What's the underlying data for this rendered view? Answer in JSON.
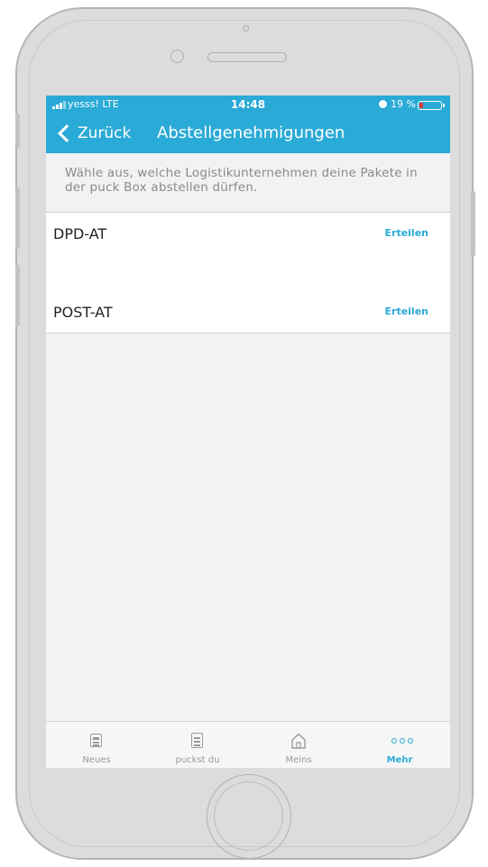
{
  "status_bar": {
    "carrier": "yesss! LTE",
    "time": "14:48",
    "battery_percent": "19 %",
    "battery_level": 0.19,
    "battery_color": "#e23b3b"
  },
  "nav": {
    "back_label": "Zurück",
    "title": "Abstellgenehmigungen"
  },
  "description": "Wähle aus, welche Logistikunternehmen deine Pakete in der puck Box abstellen dürfen.",
  "carriers": [
    {
      "name": "DPD-AT",
      "action": "Erteilen"
    },
    {
      "name": "POST-AT",
      "action": "Erteilen"
    }
  ],
  "tabs": [
    {
      "label": "Neues",
      "icon": "news-icon"
    },
    {
      "label": "puckst du",
      "icon": "box-icon"
    },
    {
      "label": "Meins",
      "icon": "home-icon"
    },
    {
      "label": "Mehr",
      "icon": "more-icon",
      "active": true
    }
  ],
  "colors": {
    "accent": "#2aaad6",
    "background": "#f2f2f2"
  }
}
